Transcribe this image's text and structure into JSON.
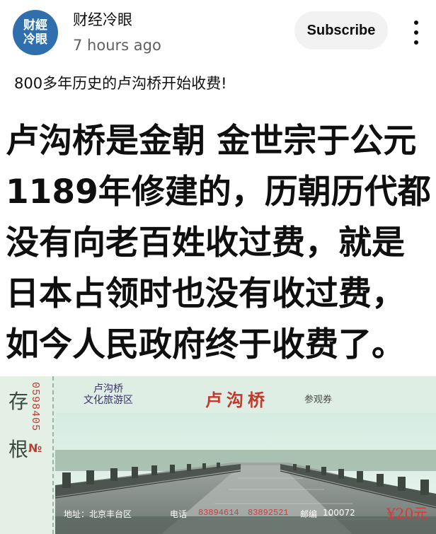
{
  "post": {
    "avatar_line1": "财經",
    "avatar_line2": "冷眼",
    "channel_name": "财经冷眼",
    "timestamp": "7 hours ago",
    "subscribe_label": "Subscribe",
    "caption": "800多年历史的卢沟桥开始收费!"
  },
  "meme": {
    "lines": [
      "卢沟桥是金朝 金世宗于公元",
      "1189年修建的，历朝历代都",
      "没有向老百姓收过费，就是",
      "日本占领时也没有收过费，",
      "如今人民政府终于收费了。"
    ]
  },
  "ticket": {
    "stub_char1": "存",
    "stub_char2": "根",
    "serial_prefix": "№",
    "serial": "0598405",
    "area_line1": "卢沟桥",
    "area_line2": "文化旅游区",
    "title": "卢沟桥",
    "kind": "参观券",
    "address": "地址：北京丰台区",
    "phone_label": "电话",
    "phone1": "83894614",
    "phone2": "83892521",
    "postcode_label": "邮编",
    "postcode": "100072",
    "price": "¥20元"
  },
  "colors": {
    "avatar_bg": "#2f6fae",
    "subscribe_bg": "#f2f2f2",
    "ticket_bg": "#dfeee4",
    "ticket_red": "#d83838"
  },
  "icons": {
    "more": "more-vert-icon"
  }
}
